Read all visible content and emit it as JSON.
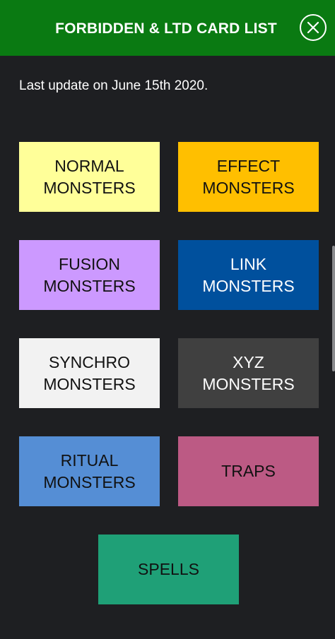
{
  "header": {
    "title": "FORBIDDEN & LTD CARD LIST",
    "close_icon": "close-circle-icon"
  },
  "update_text": "Last update on June 15th 2020.",
  "colors": {
    "header_bg": "#0a7a12",
    "page_bg": "#1e1f22",
    "normal": "#ffff99",
    "effect": "#ffbf00",
    "fusion": "#cc99ff",
    "link": "#00509d",
    "synchro": "#f2f2f2",
    "xyz": "#404040",
    "ritual": "#558ed5",
    "traps": "#bc5a84",
    "spells": "#1fa077"
  },
  "tiles": {
    "normal": "NORMAL\nMONSTERS",
    "effect": "EFFECT\nMONSTERS",
    "fusion": "FUSION\nMONSTERS",
    "link": "LINK\nMONSTERS",
    "synchro": "SYNCHRO\nMONSTERS",
    "xyz": "XYZ\nMONSTERS",
    "ritual": "RITUAL\nMONSTERS",
    "traps": "TRAPS",
    "spells": "SPELLS"
  }
}
